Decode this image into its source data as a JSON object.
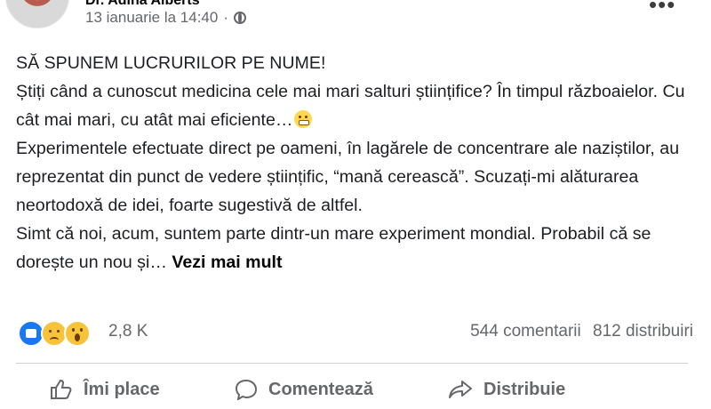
{
  "post": {
    "author": "Dr. Adina Alberts",
    "timestamp": "13 ianuarie la 14:40",
    "dot": "·",
    "more": "•••",
    "paragraph1": "SĂ SPUNEM LUCRURILOR PE NUME!",
    "paragraph2": "Știți când a cunoscut medicina cele mai mari salturi științifice? În timpul războaielor. Cu cât mai mari, cu atât mai eficiente…",
    "paragraph3": "Experimentele efectuate direct pe oameni, în lagărele de concentrare ale naziștilor, au reprezentat din punct de vedere științific, “mană cerească”. Scuzați-mi alăturarea neortodoxă de idei, foarte sugestivă de altfel.",
    "paragraph4": "Simt că noi, acum, suntem parte dintr-un mare experiment mondial. Probabil că se dorește un nou și…",
    "see_more": "Vezi mai mult"
  },
  "reactions": {
    "icons": [
      "like-icon",
      "sad-icon",
      "wow-icon"
    ],
    "count": "2,8 K",
    "comments": "544 comentarii",
    "shares": "812 distribuiri"
  },
  "actions": {
    "like": "Îmi place",
    "comment": "Comentează",
    "share": "Distribuie"
  },
  "colors": {
    "secondary_text": "#65676b",
    "like_blue": "#1877f2",
    "reaction_yellow": "#f7c33a",
    "divider": "#ced0d4"
  }
}
